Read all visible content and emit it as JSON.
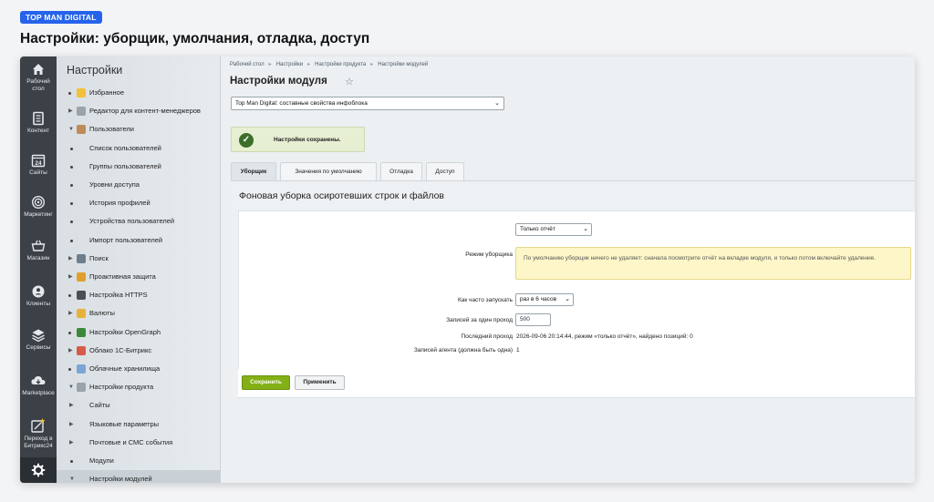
{
  "brand": "TOP MAN DIGITAL",
  "page_heading": "Настройки: уборщик, умолчания, отладка, доступ",
  "rail": [
    {
      "icon": "home-icon",
      "label": "Рабочий стол"
    },
    {
      "icon": "document-icon",
      "label": "Контент"
    },
    {
      "icon": "calendar-icon",
      "label": "Сайты"
    },
    {
      "icon": "target-icon",
      "label": "Маркетинг"
    },
    {
      "icon": "cart-icon",
      "label": "Магазин"
    },
    {
      "icon": "clients-icon",
      "label": "Клиенты"
    },
    {
      "icon": "layers-icon",
      "label": "Сервисы"
    },
    {
      "icon": "cloud-download-icon",
      "label": "Marketplace"
    },
    {
      "icon": "bitrix24-icon",
      "label": "Переход в Битрикс24"
    },
    {
      "icon": "gear-icon",
      "label": ""
    }
  ],
  "sidebar": {
    "title": "Настройки",
    "items": [
      {
        "label": "Избранное",
        "kind": "dot",
        "icon_color": "#f2c13a"
      },
      {
        "label": "Редактор для контент-менеджеров",
        "kind": "arrow",
        "icon_color": "#9aa3aa"
      },
      {
        "label": "Пользователи",
        "kind": "open",
        "icon_color": "#c08a5a"
      },
      {
        "label": "Список пользователей",
        "kind": "sub"
      },
      {
        "label": "Группы пользователей",
        "kind": "sub"
      },
      {
        "label": "Уровни доступа",
        "kind": "sub"
      },
      {
        "label": "История профилей",
        "kind": "sub"
      },
      {
        "label": "Устройства пользователей",
        "kind": "sub"
      },
      {
        "label": "Импорт пользователей",
        "kind": "sub"
      },
      {
        "label": "Поиск",
        "kind": "arrow",
        "icon_color": "#6d7f8c"
      },
      {
        "label": "Проактивная защита",
        "kind": "arrow",
        "icon_color": "#e0a02a"
      },
      {
        "label": "Настройка HTTPS",
        "kind": "dot",
        "icon_color": "#4a4f55"
      },
      {
        "label": "Валюты",
        "kind": "arrow",
        "icon_color": "#e6b23a"
      },
      {
        "label": "Настройки OpenGraph",
        "kind": "dot",
        "icon_color": "#3a8a3a"
      },
      {
        "label": "Облако 1С-Битрикс",
        "kind": "arrow",
        "icon_color": "#d85a4a"
      },
      {
        "label": "Облачные хранилища",
        "kind": "dot",
        "icon_color": "#7aa6d6"
      },
      {
        "label": "Настройки продукта",
        "kind": "open",
        "icon_color": "#9aa3aa"
      },
      {
        "label": "Сайты",
        "kind": "arrow-sub"
      },
      {
        "label": "Языковые параметры",
        "kind": "arrow-sub"
      },
      {
        "label": "Почтовые и СМС события",
        "kind": "arrow-sub"
      },
      {
        "label": "Модули",
        "kind": "sub"
      },
      {
        "label": "Настройки модулей",
        "kind": "open-sub",
        "active": true
      }
    ]
  },
  "breadcrumbs": [
    "Рабочий стол",
    "Настройки",
    "Настройки продукта",
    "Настройки модулей"
  ],
  "main_title": "Настройки модуля",
  "module_select": "Top Man Digital: составные свойства инфоблока",
  "notice": "Настройки сохранены.",
  "tabs": [
    "Уборщик",
    "Значения по умолчанию",
    "Отладка",
    "Доступ"
  ],
  "section_title": "Фоновая уборка осиротевших строк и файлов",
  "form": {
    "mode_select": "Только отчёт",
    "mode_label": "Режим уборщика",
    "mode_hint": "По умолчанию уборщик ничего не удаляет: сначала посмотрите отчёт на вкладке модуля, и только потом включайте удаление.",
    "freq_label": "Как часто запускать",
    "freq_select": "раз в 6 часов",
    "batch_label": "Записей за один проход",
    "batch_value": "500",
    "last_label": "Последний проход",
    "last_value": "2026-09-06 20:14:44, режим «только отчёт», найдено позиций: 0",
    "agents_label": "Записей агента (должна быть одна)",
    "agents_value": "1"
  },
  "buttons": {
    "save": "Сохранить",
    "apply": "Применить"
  }
}
